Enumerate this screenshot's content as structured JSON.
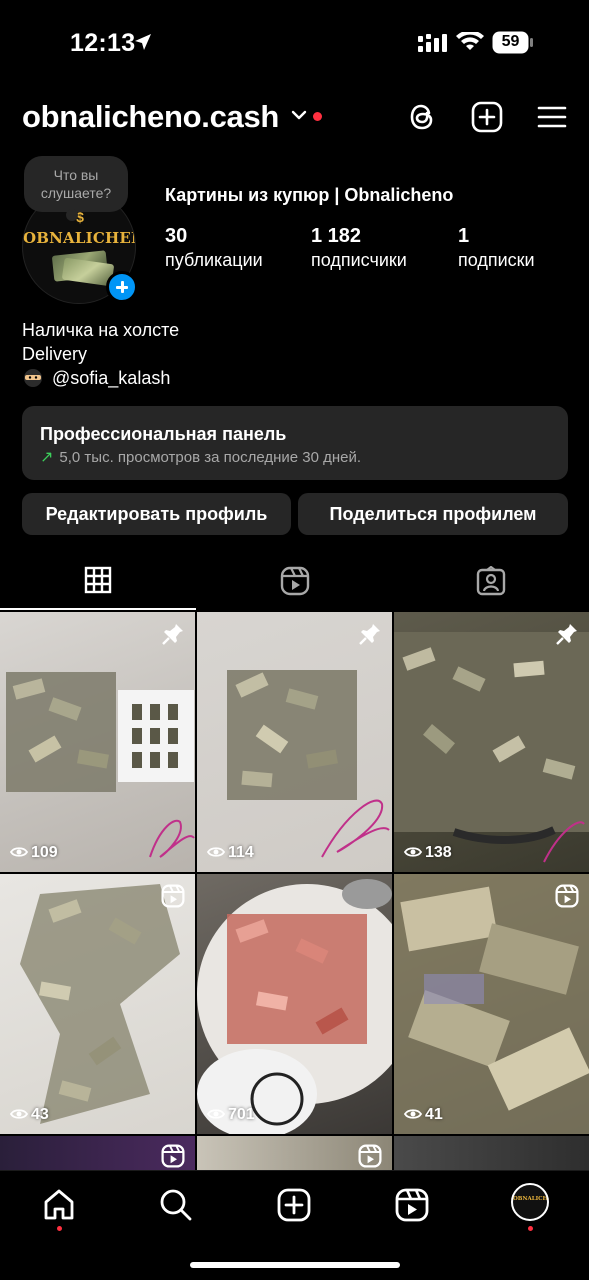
{
  "status_bar": {
    "time": "12:13",
    "battery": "59",
    "icons": [
      "location-arrow-icon",
      "cellular-signal-icon",
      "wifi-icon",
      "battery-icon"
    ]
  },
  "header": {
    "username": "obnalicheno.cash",
    "icons": [
      "chevron-down-icon",
      "threads-icon",
      "create-plus-icon",
      "menu-icon"
    ]
  },
  "profile": {
    "note": "Что вы слушаете?",
    "avatar_text": "OBNALICHENO",
    "avatar_symbol": "$",
    "display_name": "Картины из купюр | Obnalicheno",
    "stats": [
      {
        "value": "30",
        "label": "публикации"
      },
      {
        "value": "1 182",
        "label": "подписчики"
      },
      {
        "value": "1",
        "label": "подписки"
      }
    ],
    "bio": [
      "Наличка на холсте",
      "Delivery"
    ],
    "mention": "@sofia_kalash"
  },
  "pro_panel": {
    "title": "Профессиональная панель",
    "subtitle": "5,0 тыс. просмотров за последние 30 дней."
  },
  "buttons": {
    "edit": "Редактировать профиль",
    "share": "Поделиться профилем"
  },
  "tabs": [
    "grid-icon",
    "reels-icon",
    "tagged-icon"
  ],
  "posts": [
    {
      "views": "109",
      "badge": "pin-icon"
    },
    {
      "views": "114",
      "badge": "pin-icon"
    },
    {
      "views": "138",
      "badge": "pin-icon"
    },
    {
      "views": "43",
      "badge": "reel-icon"
    },
    {
      "views": "701",
      "badge": "none"
    },
    {
      "views": "41",
      "badge": "reel-icon"
    }
  ],
  "bottom_nav": [
    "home-icon",
    "search-icon",
    "create-icon",
    "reels-icon",
    "profile-avatar"
  ],
  "colors": {
    "background": "#000000",
    "surface": "#262626",
    "accent": "#0095f6",
    "notification": "#ff3040",
    "gold": "#e8b33c"
  }
}
